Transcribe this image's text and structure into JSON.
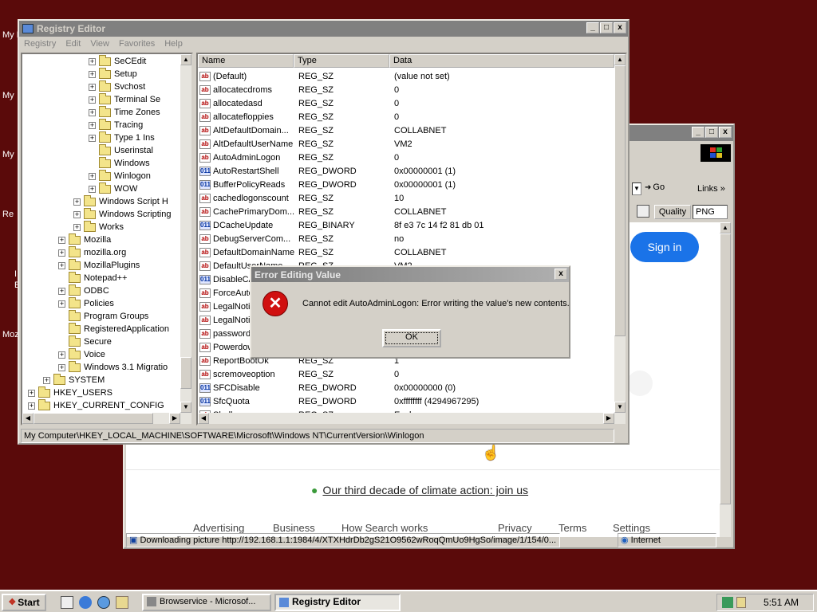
{
  "desktop_labels": [
    "My D",
    "My",
    "My",
    "Re",
    "I",
    "E",
    "Moz"
  ],
  "browser": {
    "title_controls": [
      "_",
      "□",
      "x"
    ],
    "go_label": "Go",
    "links_label": "Links",
    "quality_label": "Quality",
    "format_value": "PNG",
    "sign_in": "Sign in",
    "climate_text": "Our third decade of climate action: join us",
    "footer_links": [
      "Advertising",
      "Business",
      "How Search works",
      "Privacy",
      "Terms",
      "Settings"
    ],
    "status_text": "Downloading picture http://192.168.1.1:1984/4/XTXHdrDb2gS21O9562wRoqQmUo9HgSo/image/1/154/0...",
    "zone_text": "Internet"
  },
  "regedit": {
    "title": "Registry Editor",
    "menu": [
      "Registry",
      "Edit",
      "View",
      "Favorites",
      "Help"
    ],
    "tree": [
      {
        "label": "SeCEdit",
        "indent": 3,
        "expand": true
      },
      {
        "label": "Setup",
        "indent": 3,
        "expand": true
      },
      {
        "label": "Svchost",
        "indent": 3,
        "expand": true
      },
      {
        "label": "Terminal Se",
        "indent": 3,
        "expand": true
      },
      {
        "label": "Time Zones",
        "indent": 3,
        "expand": true
      },
      {
        "label": "Tracing",
        "indent": 3,
        "expand": true
      },
      {
        "label": "Type 1 Ins",
        "indent": 3,
        "expand": true
      },
      {
        "label": "Userinstal",
        "indent": 3,
        "expand": false
      },
      {
        "label": "Windows",
        "indent": 3,
        "expand": false
      },
      {
        "label": "Winlogon",
        "indent": 3,
        "expand": true
      },
      {
        "label": "WOW",
        "indent": 3,
        "expand": true
      },
      {
        "label": "Windows Script H",
        "indent": 2,
        "expand": true
      },
      {
        "label": "Windows Scripting",
        "indent": 2,
        "expand": true
      },
      {
        "label": "Works",
        "indent": 2,
        "expand": true
      },
      {
        "label": "Mozilla",
        "indent": 1,
        "expand": true
      },
      {
        "label": "mozilla.org",
        "indent": 1,
        "expand": true
      },
      {
        "label": "MozillaPlugins",
        "indent": 1,
        "expand": true
      },
      {
        "label": "Notepad++",
        "indent": 1,
        "expand": false
      },
      {
        "label": "ODBC",
        "indent": 1,
        "expand": true
      },
      {
        "label": "Policies",
        "indent": 1,
        "expand": true
      },
      {
        "label": "Program Groups",
        "indent": 1,
        "expand": false
      },
      {
        "label": "RegisteredApplication",
        "indent": 1,
        "expand": false
      },
      {
        "label": "Secure",
        "indent": 1,
        "expand": false
      },
      {
        "label": "Voice",
        "indent": 1,
        "expand": true
      },
      {
        "label": "Windows 3.1 Migratio",
        "indent": 1,
        "expand": true
      },
      {
        "label": "SYSTEM",
        "indent": 0,
        "expand": true
      },
      {
        "label": "HKEY_USERS",
        "indent": -1,
        "expand": true
      },
      {
        "label": "HKEY_CURRENT_CONFIG",
        "indent": -1,
        "expand": true
      }
    ],
    "columns": [
      "Name",
      "Type",
      "Data"
    ],
    "values": [
      {
        "name": "(Default)",
        "type": "REG_SZ",
        "data": "(value not set)",
        "icon": "sz"
      },
      {
        "name": "allocatecdroms",
        "type": "REG_SZ",
        "data": "0",
        "icon": "sz"
      },
      {
        "name": "allocatedasd",
        "type": "REG_SZ",
        "data": "0",
        "icon": "sz"
      },
      {
        "name": "allocatefloppies",
        "type": "REG_SZ",
        "data": "0",
        "icon": "sz"
      },
      {
        "name": "AltDefaultDomain...",
        "type": "REG_SZ",
        "data": "COLLABNET",
        "icon": "sz"
      },
      {
        "name": "AltDefaultUserName",
        "type": "REG_SZ",
        "data": "VM2",
        "icon": "sz"
      },
      {
        "name": "AutoAdminLogon",
        "type": "REG_SZ",
        "data": "0",
        "icon": "sz"
      },
      {
        "name": "AutoRestartShell",
        "type": "REG_DWORD",
        "data": "0x00000001 (1)",
        "icon": "bin"
      },
      {
        "name": "BufferPolicyReads",
        "type": "REG_DWORD",
        "data": "0x00000001 (1)",
        "icon": "bin"
      },
      {
        "name": "cachedlogonscount",
        "type": "REG_SZ",
        "data": "10",
        "icon": "sz"
      },
      {
        "name": "CachePrimaryDom...",
        "type": "REG_SZ",
        "data": "COLLABNET",
        "icon": "sz"
      },
      {
        "name": "DCacheUpdate",
        "type": "REG_BINARY",
        "data": "8f e3 7c 14 f2 81 db 01",
        "icon": "bin"
      },
      {
        "name": "DebugServerCom...",
        "type": "REG_SZ",
        "data": "no",
        "icon": "sz"
      },
      {
        "name": "DefaultDomainName",
        "type": "REG_SZ",
        "data": "COLLABNET",
        "icon": "sz"
      },
      {
        "name": "DefaultUserName",
        "type": "REG_SZ",
        "data": "VM2",
        "icon": "sz"
      },
      {
        "name": "DisableCA",
        "type": "",
        "data": "",
        "icon": "bin"
      },
      {
        "name": "ForceAuto",
        "type": "",
        "data": "",
        "icon": "sz"
      },
      {
        "name": "LegalNoti",
        "type": "",
        "data": "",
        "icon": "sz"
      },
      {
        "name": "LegalNoti",
        "type": "",
        "data": "",
        "icon": "sz"
      },
      {
        "name": "password",
        "type": "",
        "data": "",
        "icon": "sz"
      },
      {
        "name": "Powerdow",
        "type": "",
        "data": "",
        "icon": "sz"
      },
      {
        "name": "ReportBootOk",
        "type": "REG_SZ",
        "data": "1",
        "icon": "sz"
      },
      {
        "name": "scremoveoption",
        "type": "REG_SZ",
        "data": "0",
        "icon": "sz"
      },
      {
        "name": "SFCDisable",
        "type": "REG_DWORD",
        "data": "0x00000000 (0)",
        "icon": "bin"
      },
      {
        "name": "SfcQuota",
        "type": "REG_DWORD",
        "data": "0xffffffff (4294967295)",
        "icon": "bin"
      },
      {
        "name": "Shell",
        "type": "REG_SZ",
        "data": "Explorer.exe",
        "icon": "sz"
      }
    ],
    "statusbar": "My Computer\\HKEY_LOCAL_MACHINE\\SOFTWARE\\Microsoft\\Windows NT\\CurrentVersion\\Winlogon"
  },
  "dialog": {
    "title": "Error Editing Value",
    "message": "Cannot edit AutoAdminLogon:  Error writing the value's new contents.",
    "ok_label": "OK"
  },
  "taskbar": {
    "start_label": "Start",
    "tasks": [
      "Browservice - Microsof...",
      "Registry Editor"
    ],
    "clock": "5:51 AM"
  },
  "colors": {
    "desktop": "#5a0a0a",
    "error_red": "#d01010",
    "google_blue": "#1a73e8"
  }
}
